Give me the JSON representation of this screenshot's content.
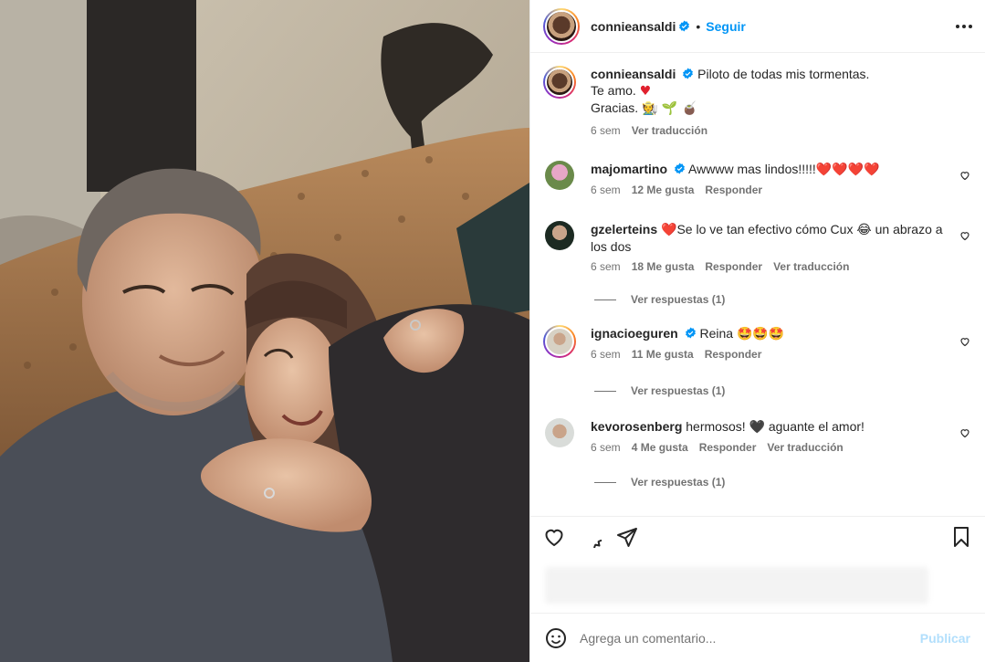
{
  "post": {
    "author": "connieansaldi",
    "follow_label": "Seguir",
    "dot": "•",
    "more_icon": "more-options-icon"
  },
  "caption": {
    "user": "connieansaldi",
    "line1": "Piloto de todas mis tormentas.",
    "line2": "Te amo.",
    "line3": "Gracias.",
    "line3_emoji": "🧑‍🌾 🌱 🧉",
    "time": "6 sem",
    "translate": "Ver traducción"
  },
  "comments": [
    {
      "user": "majomartino",
      "verified": true,
      "text": "Awwww mas lindos!!!!!",
      "emoji": "❤️❤️❤️❤️",
      "time": "6 sem",
      "likes": "12 Me gusta",
      "reply": "Responder",
      "translate": ""
    },
    {
      "user": "gzelerteins",
      "verified": false,
      "emoji_pre": "❤️",
      "text": "Se lo ve tan efectivo cómo Cux",
      "emoji": "😂",
      "text2": "un abrazo a",
      "text3": "los dos",
      "time": "6 sem",
      "likes": "18 Me gusta",
      "reply": "Responder",
      "translate": "Ver traducción",
      "replies": "Ver respuestas (1)"
    },
    {
      "user": "ignacioeguren",
      "verified": true,
      "text": "Reina",
      "emoji": "🤩🤩🤩",
      "time": "6 sem",
      "likes": "11 Me gusta",
      "reply": "Responder",
      "replies": "Ver respuestas (1)"
    },
    {
      "user": "kevorosenberg",
      "verified": false,
      "text": "hermosos!",
      "emoji": "🖤",
      "text2": "aguante el amor!",
      "time": "6 sem",
      "likes": "4 Me gusta",
      "reply": "Responder",
      "translate": "Ver traducción",
      "replies": "Ver respuestas (1)"
    }
  ],
  "actions": {
    "like_icon": "heart-icon",
    "comment_icon": "comment-icon",
    "share_icon": "share-icon",
    "save_icon": "bookmark-icon"
  },
  "composer": {
    "placeholder": "Agrega un comentario...",
    "post_label": "Publicar",
    "emoji_icon": "emoji-icon"
  },
  "colors": {
    "link": "#0095f6",
    "verified": "#0095f6",
    "heart": "#e0202e",
    "muted": "#737373"
  }
}
